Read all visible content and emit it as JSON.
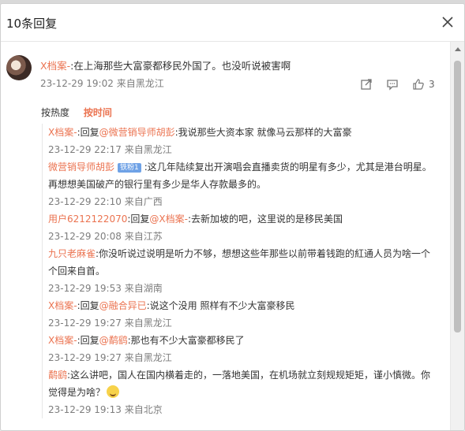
{
  "window": {
    "title": "10条回复"
  },
  "main_comment": {
    "user": "X档案-",
    "text": ":在上海那些大富豪都移民外国了。也没听说被害啊",
    "time": "23-12-29 19:02",
    "location": "来自黑龙江",
    "like_count": "3"
  },
  "sort": {
    "hot": "按热度",
    "time": "按时间"
  },
  "replies": [
    {
      "user": "X档案-",
      "reply_word": ":回复",
      "target": "@微营销导师胡彭",
      "text": ":我说那些大资本家  就像马云那样的大富豪",
      "time": "23-12-29 22:17",
      "location": "来自黑龙江"
    },
    {
      "user": "微营销导师胡彭",
      "badge": "铁粉1",
      "text": ":这几年陆续复出开演唱会直播卖货的明星有多少，尤其是港台明星。再想想美国破产的银行里有多少是华人存款最多的。",
      "time": "23-12-29 22:10",
      "location": "来自广西"
    },
    {
      "user": "用户6212122070",
      "reply_word": ":回复",
      "target": "@X档案-",
      "text": ":去新加坡的吧，这里说的是移民美国",
      "time": "23-12-29 20:08",
      "location": "来自江苏"
    },
    {
      "user": "九只老麻雀",
      "text": ":你没听说过说明是听力不够，想想这些年那些以前带着钱跑的紅通人员为啥一个个回来自首。",
      "time": "23-12-29 19:53",
      "location": "来自湖南"
    },
    {
      "user": "X档案-",
      "reply_word": ":回复",
      "target": "@融合异已",
      "text": ":说这个没用 照样有不少大富豪移民",
      "time": "23-12-29 19:27",
      "location": "来自黑龙江"
    },
    {
      "user": "X档案-",
      "reply_word": ":回复",
      "target": "@鹬鹞",
      "text": ":那也有不少大富豪都移民了",
      "time": "23-12-29 19:27",
      "location": "来自黑龙江"
    },
    {
      "user": "鹬鹞",
      "text": ":这么讲吧，国人在国内横着走的，一落地美国，在机场就立刻规规矩矩，谨小慎微。你觉得是为啥？",
      "emoji": "laugh-emoji",
      "time": "23-12-29 19:13",
      "location": "来自北京"
    }
  ],
  "colors": {
    "username": "#eb7350",
    "meta": "#7d7d7d",
    "text": "#333333"
  }
}
